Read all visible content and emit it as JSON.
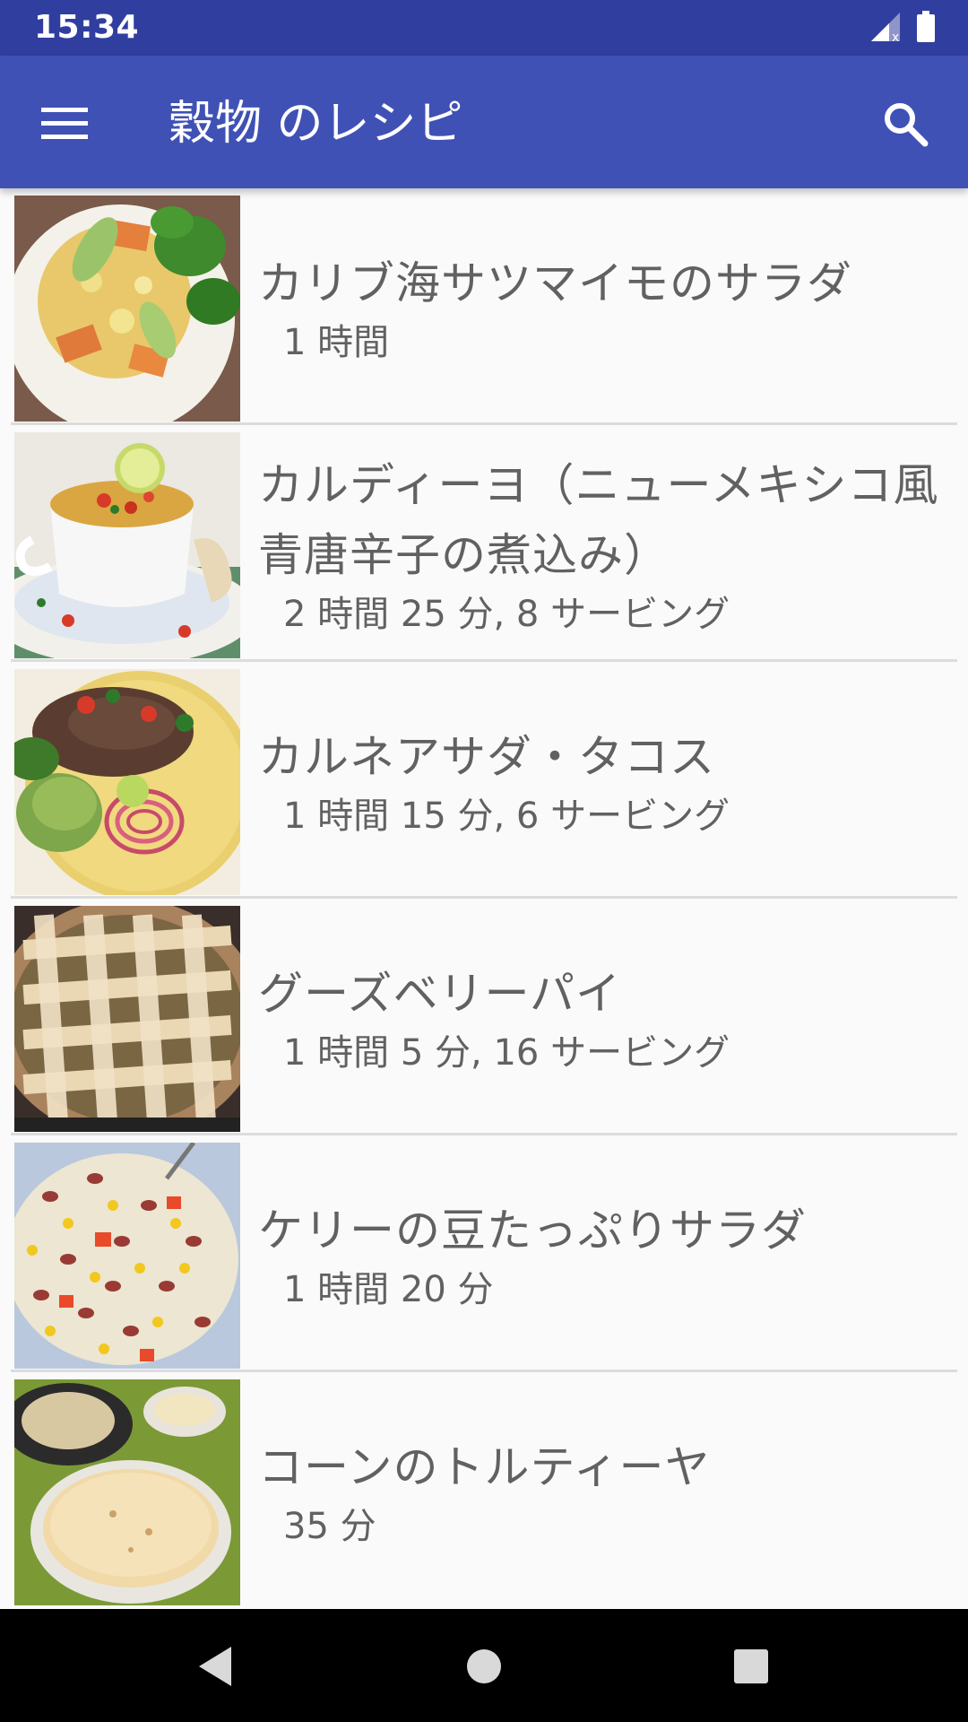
{
  "status_bar": {
    "time": "15:34",
    "icons": [
      "signal-icon",
      "battery-icon"
    ]
  },
  "app_bar": {
    "title": "穀物 のレシピ",
    "menu_icon": "hamburger-menu-icon",
    "search_icon": "search-icon",
    "color": "#3f51b5",
    "status_color": "#303f9f"
  },
  "recipes": [
    {
      "title": "カリブ海サツマイモのサラダ",
      "meta": "1 時間",
      "image": "salad-photo"
    },
    {
      "title": "カルディーヨ（ニューメキシコ風青唐辛子の煮込み）",
      "meta": "2 時間 25 分, 8 サービング",
      "image": "soup-photo"
    },
    {
      "title": "カルネアサダ・タコス",
      "meta": "1 時間 15 分, 6 サービング",
      "image": "tacos-photo"
    },
    {
      "title": "グーズベリーパイ",
      "meta": "1 時間 5 分, 16 サービング",
      "image": "pie-photo"
    },
    {
      "title": "ケリーの豆たっぷりサラダ",
      "meta": "1 時間 20 分",
      "image": "bean-salad-photo"
    },
    {
      "title": "コーンのトルティーヤ",
      "meta": "35 分",
      "image": "tortilla-photo"
    }
  ],
  "nav_bar": {
    "buttons": [
      "back-icon",
      "home-icon",
      "recents-icon"
    ]
  }
}
